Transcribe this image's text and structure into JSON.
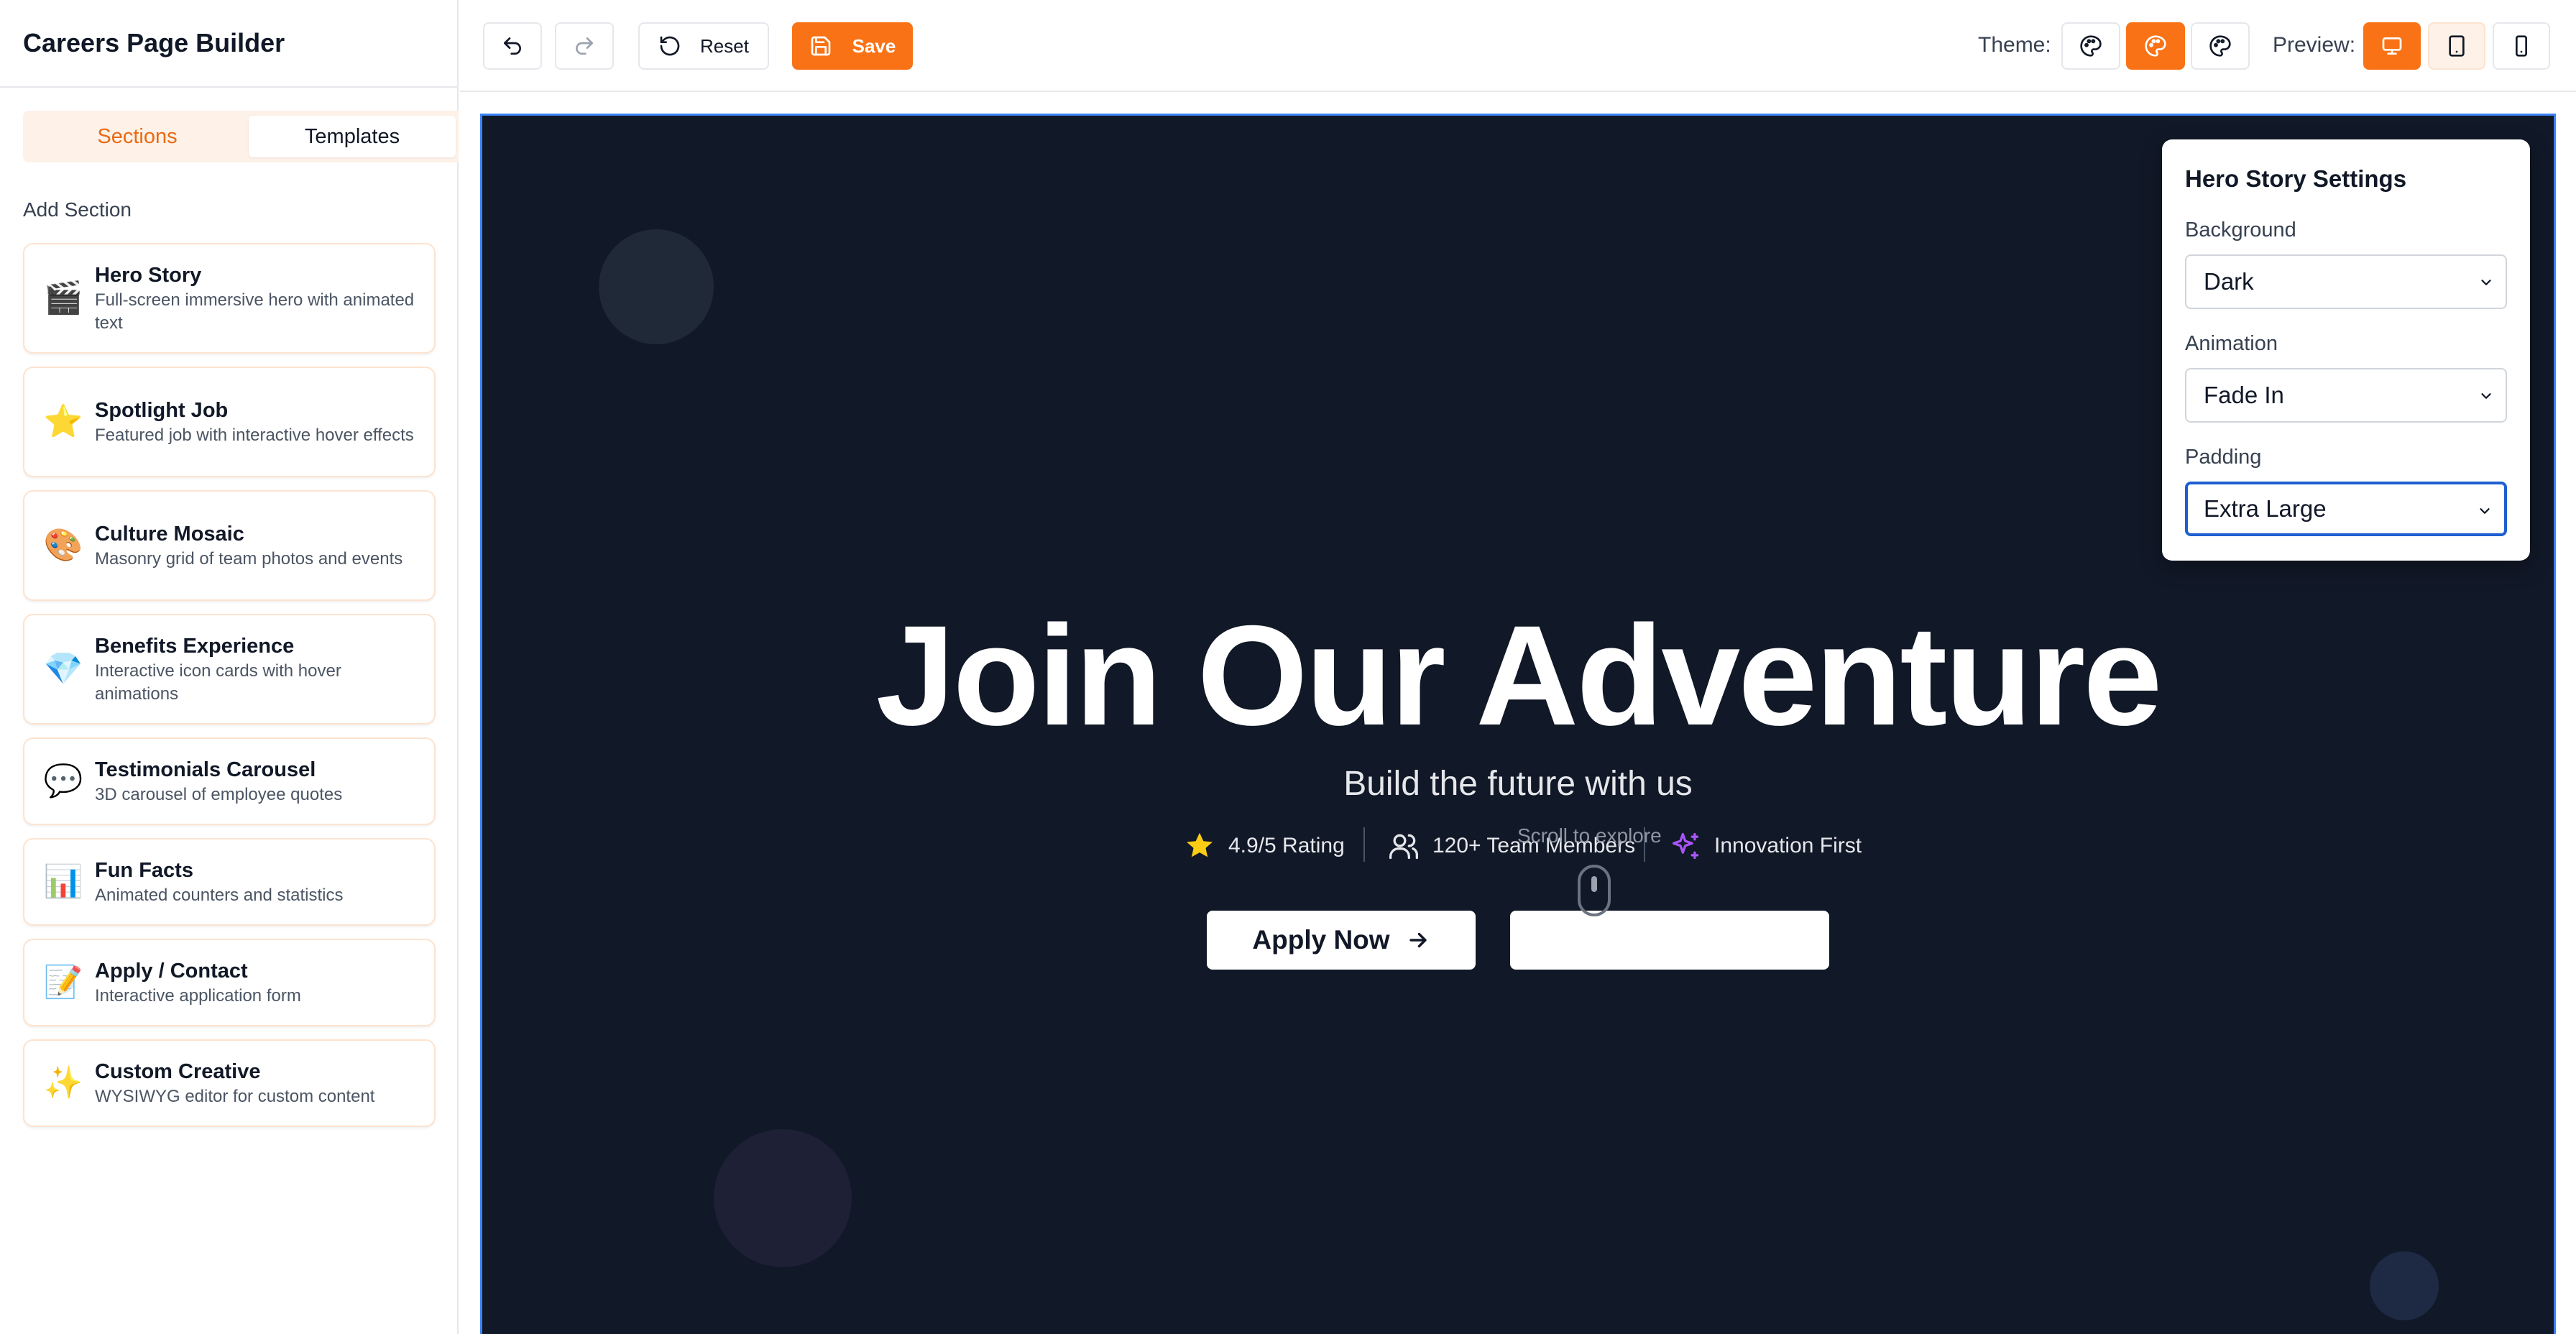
{
  "app": {
    "title": "Careers Page Builder"
  },
  "sidebar": {
    "tabs": [
      {
        "label": "Sections",
        "active": true
      },
      {
        "label": "Templates",
        "active": false
      }
    ],
    "add_section_label": "Add Section",
    "sections": [
      {
        "icon": "clapperboard-icon",
        "glyph": "🎬",
        "title": "Hero Story",
        "description": "Full-screen immersive hero with animated text"
      },
      {
        "icon": "star-icon",
        "glyph": "⭐",
        "title": "Spotlight Job",
        "description": "Featured job with interactive hover effects"
      },
      {
        "icon": "palette-icon",
        "glyph": "🎨",
        "title": "Culture Mosaic",
        "description": "Masonry grid of team photos and events"
      },
      {
        "icon": "gem-icon",
        "glyph": "💎",
        "title": "Benefits Experience",
        "description": "Interactive icon cards with hover animations"
      },
      {
        "icon": "speech-bubble-icon",
        "glyph": "💬",
        "title": "Testimonials Carousel",
        "description": "3D carousel of employee quotes"
      },
      {
        "icon": "bar-chart-icon",
        "glyph": "📊",
        "title": "Fun Facts",
        "description": "Animated counters and statistics"
      },
      {
        "icon": "memo-icon",
        "glyph": "📝",
        "title": "Apply / Contact",
        "description": "Interactive application form"
      },
      {
        "icon": "sparkles-icon",
        "glyph": "✨",
        "title": "Custom Creative",
        "description": "WYSIWYG editor for custom content"
      }
    ]
  },
  "toolbar": {
    "reset_label": "Reset",
    "save_label": "Save",
    "theme_label": "Theme:",
    "preview_label": "Preview:",
    "active_theme": "orange",
    "active_preview": "desktop",
    "colors": {
      "accent": "#f97316",
      "canvas_bg": "#111827",
      "selection": "#3b82f6"
    }
  },
  "hero": {
    "title": "Join Our Adventure",
    "subtitle": "Build the future with us",
    "stats": [
      {
        "icon": "star-icon",
        "label": "4.9/5 Rating"
      },
      {
        "icon": "users-icon",
        "label": "120+ Team Members"
      },
      {
        "icon": "sparkles-icon",
        "label": "Innovation First"
      }
    ],
    "scroll_hint": "Scroll to explore",
    "primary_cta": "Apply Now",
    "secondary_cta": ""
  },
  "settings": {
    "title": "Hero Story Settings",
    "background": {
      "label": "Background",
      "value": "Dark"
    },
    "animation": {
      "label": "Animation",
      "value": "Fade In"
    },
    "padding": {
      "label": "Padding",
      "value": "Extra Large"
    }
  }
}
